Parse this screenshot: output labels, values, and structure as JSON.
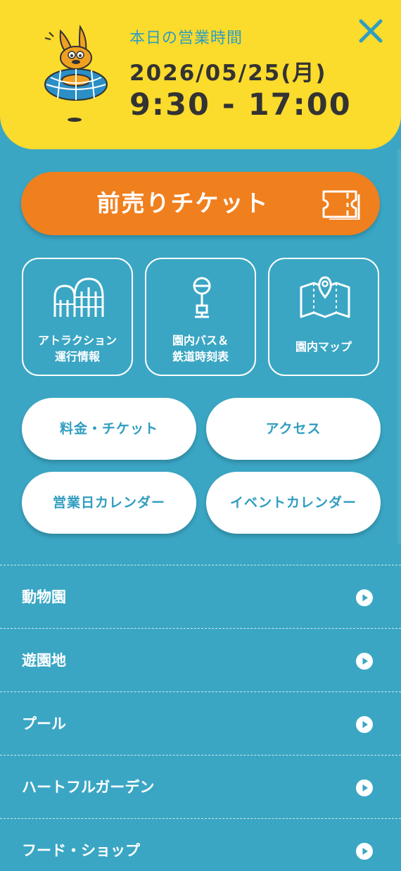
{
  "header": {
    "hours_label": "本日の営業時間",
    "date": "2026/05/25(月)",
    "time": "9:30 - 17:00",
    "mascot": "kangaroo-mascot-in-globe"
  },
  "close_icon": "close-icon",
  "primary_button": {
    "label": "前売りチケット",
    "icon": "ticket-icon"
  },
  "tiles": [
    {
      "line1": "アトラクション",
      "line2": "運行情報",
      "icon": "roller-coaster-icon"
    },
    {
      "line1": "園内バス＆",
      "line2": "鉄道時刻表",
      "icon": "bus-stop-icon"
    },
    {
      "line1": "園内マップ",
      "icon": "map-icon"
    }
  ],
  "pills": [
    {
      "label": "料金・チケット"
    },
    {
      "label": "アクセス"
    },
    {
      "label": "営業日カレンダー"
    },
    {
      "label": "イベントカレンダー"
    }
  ],
  "menu": [
    {
      "label": "動物園"
    },
    {
      "label": "遊園地"
    },
    {
      "label": "プール"
    },
    {
      "label": "ハートフルガーデン"
    },
    {
      "label": "フード・ショップ"
    }
  ],
  "colors": {
    "background": "#3aa6c4",
    "header": "#fbdb2c",
    "accent_orange": "#f07f1e",
    "text_blue": "#2f9dc0",
    "text_dark": "#333333"
  }
}
